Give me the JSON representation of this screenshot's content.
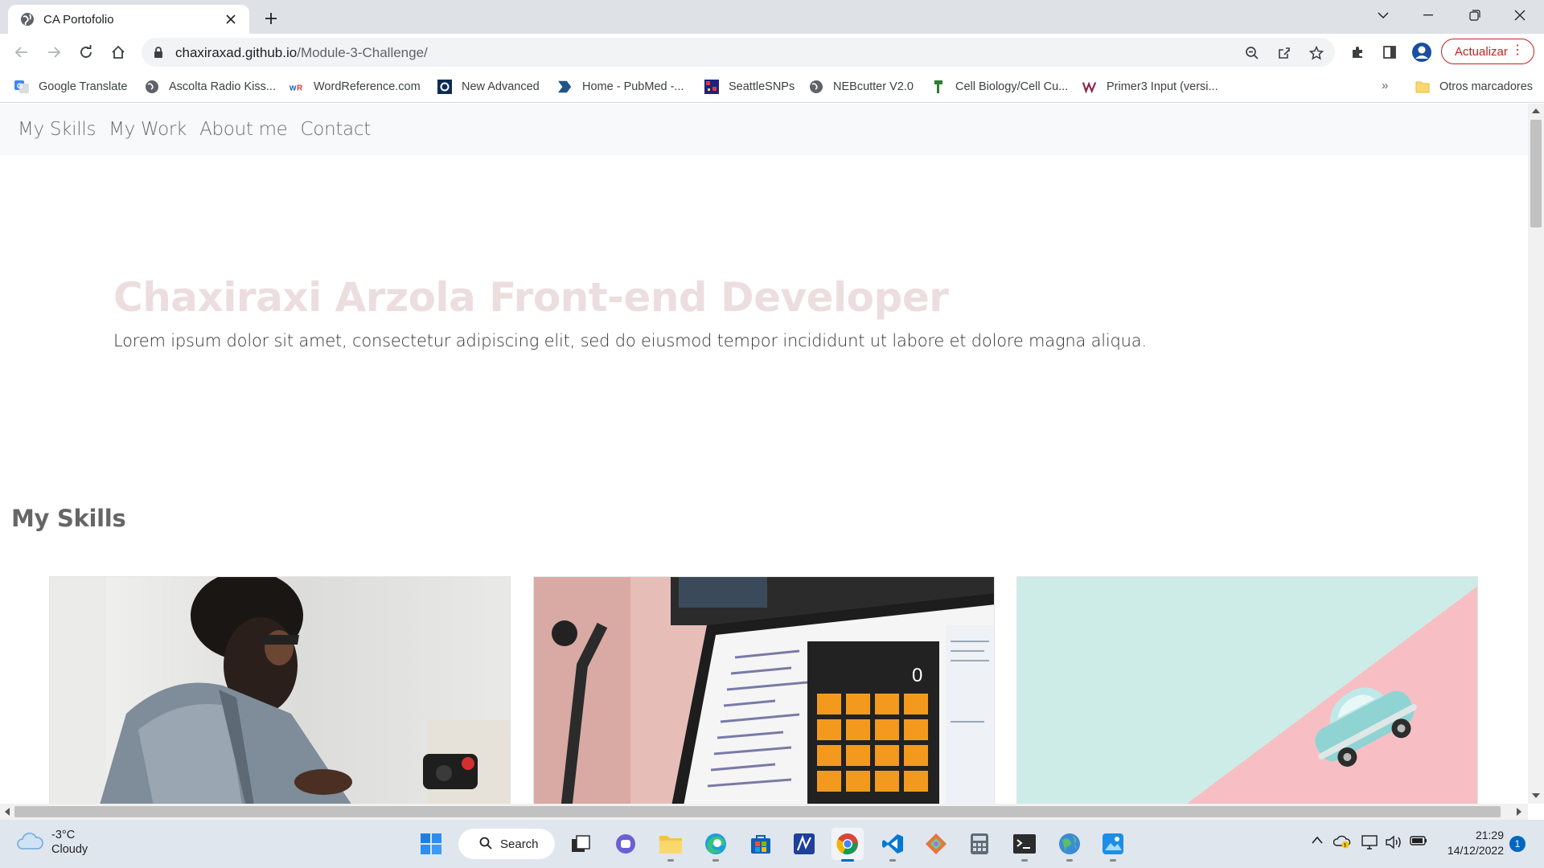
{
  "browser": {
    "tab_title": "CA Portofolio",
    "url_host": "chaxiraxad.github.io",
    "url_path": "/Module-3-Challenge/",
    "update_label": "Actualizar",
    "bookmarks": [
      {
        "label": "Google Translate",
        "icon": "google-translate-icon"
      },
      {
        "label": "Ascolta Radio Kiss...",
        "icon": "globe-icon"
      },
      {
        "label": "WordReference.com",
        "icon": "wordreference-icon"
      },
      {
        "label": "New Advanced",
        "icon": "new-advanced-icon"
      },
      {
        "label": "Home - PubMed -...",
        "icon": "pubmed-icon"
      },
      {
        "label": "SeattleSNPs",
        "icon": "seattlesnps-icon"
      },
      {
        "label": "NEBcutter V2.0",
        "icon": "globe-icon"
      },
      {
        "label": "Cell Biology/Cell Cu...",
        "icon": "cell-biology-icon"
      },
      {
        "label": "Primer3 Input (versi...",
        "icon": "primer3-icon"
      }
    ],
    "more_bookmarks": "»",
    "other_bookmarks": "Otros marcadores"
  },
  "page": {
    "nav": [
      "My Skills",
      "My Work",
      "About me",
      "Contact"
    ],
    "hero_title": "Chaxiraxi Arzola Front-end Developer",
    "hero_text": "Lorem ipsum dolor sit amet, consectetur adipiscing elit, sed do eiusmod tempor incididunt ut labore et dolore magna aliqua.",
    "section_title": "My Skills",
    "colors": {
      "hero_title": "#ecdede",
      "nav_bg": "#f8f9fa"
    }
  },
  "taskbar": {
    "weather_temp": "-3°C",
    "weather_desc": "Cloudy",
    "search_label": "Search",
    "time": "21:29",
    "date": "14/12/2022",
    "notifications": "1"
  }
}
